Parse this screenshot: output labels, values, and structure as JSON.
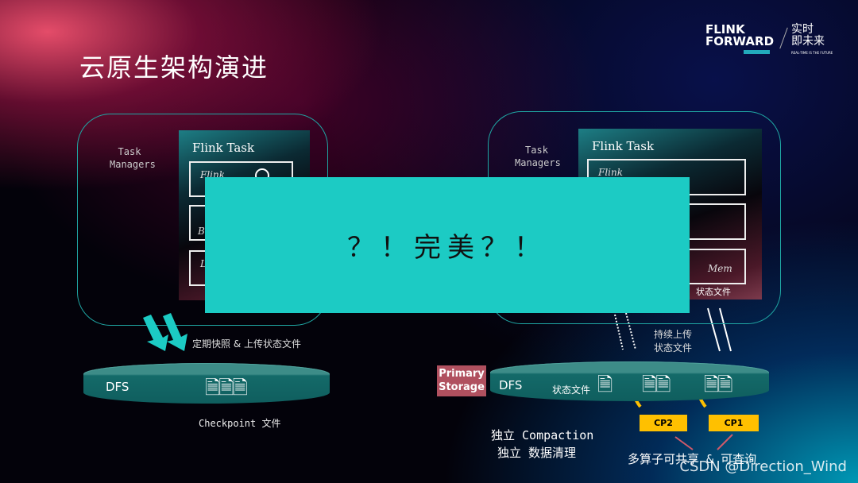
{
  "slide": {
    "title": "云原生架构演进"
  },
  "logo": {
    "line1": "FLINK",
    "line2": "FORWARD",
    "cn_line1": "实时",
    "cn_line2": "即未来",
    "tagline": "REAL-TIME IS THE FUTURE"
  },
  "left": {
    "tm_label_1": "Task",
    "tm_label_2": "Managers",
    "flink_task": "Flink Task",
    "sub1": "Flink",
    "sub2": "B",
    "sub3": "L",
    "snapshot_label": "定期快照 & 上传状态文件",
    "dfs": "DFS",
    "checkpoint_label": "Checkpoint 文件"
  },
  "overlay": {
    "text": "？！完美？！"
  },
  "right": {
    "tm_label_1": "Task",
    "tm_label_2": "Managers",
    "flink_task": "Flink Task",
    "sub1": "Flink",
    "mem": "Mem",
    "state_file_panel": "状态文件",
    "upload_label_1": "持续上传",
    "upload_label_2": "状态文件",
    "primary_1": "Primary",
    "primary_2": "Storage",
    "dfs": "DFS",
    "state_file": "状态文件",
    "cp2": "CP2",
    "cp1": "CP1",
    "compaction": "独立 Compaction",
    "cleanup": "独立 数据清理",
    "shared": "多算子可共享 & 可查询"
  },
  "watermark": "CSDN @Direction_Wind",
  "colors": {
    "overlay": "#1ccbc4",
    "border": "#1fa6a3",
    "cp": "#ffc000",
    "primary": "#b0505f"
  }
}
